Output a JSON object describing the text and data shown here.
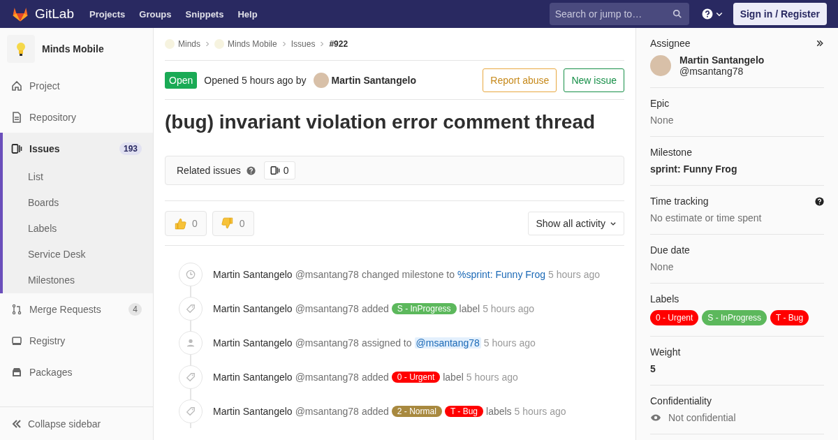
{
  "header": {
    "brand": "GitLab",
    "nav": [
      "Projects",
      "Groups",
      "Snippets",
      "Help"
    ],
    "search": {
      "placeholder": "Search or jump to…"
    },
    "sign_in": "Sign in / Register"
  },
  "sidebar": {
    "project": "Minds Mobile",
    "items": [
      {
        "label": "Project",
        "kind": "home",
        "selected": false
      },
      {
        "label": "Repository",
        "kind": "doc",
        "selected": false
      },
      {
        "label": "Issues",
        "kind": "issues",
        "selected": true,
        "count": "193",
        "children": [
          {
            "label": "List",
            "selected": false
          },
          {
            "label": "Boards",
            "selected": false
          },
          {
            "label": "Labels",
            "selected": false
          },
          {
            "label": "Service Desk",
            "selected": false
          },
          {
            "label": "Milestones",
            "selected": false
          }
        ]
      },
      {
        "label": "Merge Requests",
        "kind": "merge",
        "selected": false,
        "count": "4"
      },
      {
        "label": "Registry",
        "kind": "registry",
        "selected": false
      },
      {
        "label": "Packages",
        "kind": "package",
        "selected": false
      }
    ],
    "collapse": "Collapse sidebar"
  },
  "breadcrumbs": [
    {
      "label": "Minds",
      "avatar": true
    },
    {
      "label": "Minds Mobile",
      "avatar": true
    },
    {
      "label": "Issues",
      "avatar": false
    },
    {
      "label": "#922",
      "avatar": false
    }
  ],
  "issue": {
    "status": "Open",
    "opened": "Opened 5 hours ago by",
    "author": "Martin Santangelo",
    "buttons": [
      {
        "label": "Report abuse",
        "kind": "warning"
      },
      {
        "label": "New issue",
        "kind": "success"
      }
    ],
    "title": "(bug) invariant violation error comment thread",
    "related": {
      "label": "Related issues",
      "count": "0"
    },
    "reactions": [
      {
        "kind": "thumbsup",
        "count": "0"
      },
      {
        "kind": "thumbsdown",
        "count": "0"
      }
    ],
    "activity_filter": "Show all activity"
  },
  "notes": [
    {
      "kind": "clock",
      "parts": [
        {
          "kind": "author",
          "text": "Martin Santangelo"
        },
        {
          "kind": "handle",
          "text": "@msantang78"
        },
        {
          "kind": "text",
          "text": "changed milestone to"
        },
        {
          "kind": "link",
          "text": "%sprint: Funny Frog"
        },
        {
          "kind": "time",
          "text": "5 hours ago"
        }
      ]
    },
    {
      "kind": "tag",
      "parts": [
        {
          "kind": "author",
          "text": "Martin Santangelo"
        },
        {
          "kind": "handle",
          "text": "@msantang78"
        },
        {
          "kind": "text",
          "text": "added"
        },
        {
          "kind": "label",
          "text": "S - InProgress",
          "color": "#5cb85c"
        },
        {
          "kind": "text",
          "text": "label"
        },
        {
          "kind": "time",
          "text": "5 hours ago"
        }
      ]
    },
    {
      "kind": "person",
      "parts": [
        {
          "kind": "author",
          "text": "Martin Santangelo"
        },
        {
          "kind": "handle",
          "text": "@msantang78"
        },
        {
          "kind": "text",
          "text": "assigned to"
        },
        {
          "kind": "mention",
          "text": "@msantang78"
        },
        {
          "kind": "time",
          "text": "5 hours ago"
        }
      ]
    },
    {
      "kind": "tag",
      "parts": [
        {
          "kind": "author",
          "text": "Martin Santangelo"
        },
        {
          "kind": "handle",
          "text": "@msantang78"
        },
        {
          "kind": "text",
          "text": "added"
        },
        {
          "kind": "label",
          "text": "0 - Urgent",
          "color": "#ff0000"
        },
        {
          "kind": "text",
          "text": "label"
        },
        {
          "kind": "time",
          "text": "5 hours ago"
        }
      ]
    },
    {
      "kind": "tag",
      "parts": [
        {
          "kind": "author",
          "text": "Martin Santangelo"
        },
        {
          "kind": "handle",
          "text": "@msantang78"
        },
        {
          "kind": "text",
          "text": "added"
        },
        {
          "kind": "label",
          "text": "2 - Normal",
          "color": "#a8893f"
        },
        {
          "kind": "label",
          "text": "T - Bug",
          "color": "#ff0000"
        },
        {
          "kind": "text",
          "text": "labels"
        },
        {
          "kind": "time",
          "text": "5 hours ago"
        }
      ]
    }
  ],
  "right_sidebar": {
    "assignee": {
      "title": "Assignee",
      "name": "Martin Santangelo",
      "handle": "@msantang78"
    },
    "blocks": [
      {
        "kind": "text",
        "title": "Epic",
        "value": "None"
      },
      {
        "kind": "bold",
        "title": "Milestone",
        "value": "sprint: Funny Frog"
      },
      {
        "kind": "help",
        "title": "Time tracking",
        "value": "No estimate or time spent"
      },
      {
        "kind": "text",
        "title": "Due date",
        "value": "None"
      },
      {
        "kind": "labels",
        "title": "Labels",
        "labels": [
          {
            "text": "0 - Urgent",
            "color": "#ff0000"
          },
          {
            "text": "S - InProgress",
            "color": "#5cb85c"
          },
          {
            "text": "T - Bug",
            "color": "#ff0000"
          }
        ]
      },
      {
        "kind": "bold",
        "title": "Weight",
        "value": "5"
      },
      {
        "kind": "eye",
        "title": "Confidentiality",
        "value": "Not confidential"
      }
    ]
  }
}
